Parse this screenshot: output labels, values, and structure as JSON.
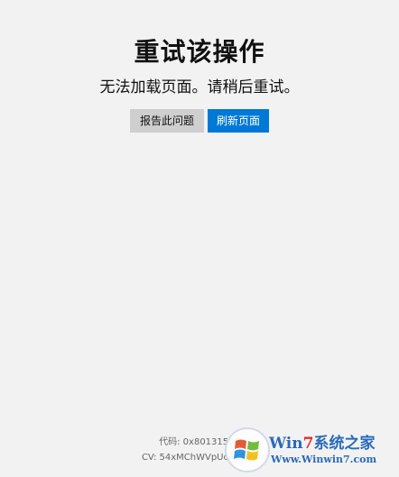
{
  "error": {
    "title": "重试该操作",
    "message": "无法加载页面。请稍后重试。"
  },
  "buttons": {
    "report_label": "报告此问题",
    "refresh_label": "刷新页面"
  },
  "footer": {
    "code_text": "代码: 0x80131500",
    "cv_text": "CV: 54xMChWVpUcAb2Vy"
  },
  "watermark": {
    "brand_prefix": "Win",
    "brand_number": "7",
    "brand_suffix": "系统之家",
    "url": "Www.Winwin7.com",
    "logo_icon": "windows-flag-icon"
  },
  "colors": {
    "background": "#f2f2f2",
    "primary_button": "#0078d7",
    "secondary_button": "#cfcfcf",
    "watermark_blue": "#1a5fb4",
    "watermark_red": "#e01b24"
  }
}
